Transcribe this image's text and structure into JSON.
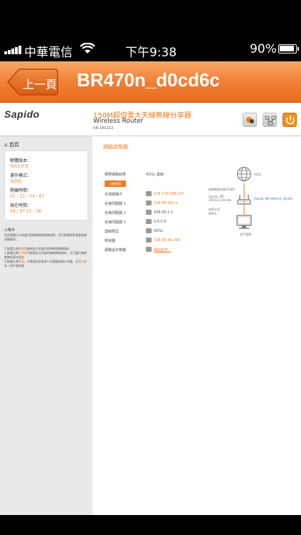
{
  "status_bar": {
    "carrier": "中華電信",
    "time": "下午9:38",
    "battery": "90%"
  },
  "nav": {
    "back_label": "上一頁",
    "title": "BR470n_d0cd6c"
  },
  "header": {
    "logo": "Sapido",
    "model_zh": "150M超值雲大天線無線分享器",
    "model_en": "Wireless Router",
    "model_no": "RB-1802G3"
  },
  "sidebar": {
    "home": "首頁",
    "firmware_label": "韌體版本：",
    "firmware_value": "Ver1.0.0",
    "mode_label": "運作模式：",
    "mode_value": "ADSL",
    "uptime_label": "開機時間：",
    "uptime_value": "01 : 12 : 34 : 47",
    "now_label": "現在時間：",
    "now_value": "04 / 07 21 : 38",
    "tip_title": "小幫手",
    "tip_body": "此頁面顯示分享器目前網際網路連線狀態，您可點擊按鈕查看連線詳細資訊。",
    "tip_steps_1a": "1.點選左側",
    "tip_steps_1b": "網路",
    "tip_steps_1c": "可檢視此分享器目前的網際網路資料",
    "tip_steps_2a": "2.點選左側",
    "tip_steps_2b": "分享器",
    "tip_steps_2c": "可檢視此分享器的無線網路資料，且可進行無線網路的基本設定",
    "tip_steps_3a": "3.點選左側",
    "tip_steps_3b": "電腦",
    "tip_steps_3c": "，可檢視目前有多少台電腦連線分享器，且可",
    "tip_steps_3d": "封鎖",
    "tip_steps_3e": "任一用戶端設備"
  },
  "main": {
    "panel_title": "網路狀態圖",
    "rows": {
      "type_label": "網際網路狀態",
      "type_value": "ADSL 連線",
      "detect_button": "自動偵測",
      "wan_ip_label": "外部網路IP",
      "wan_ip_value": "118.170.195.237",
      "dns1_label": "名稱伺服器 1",
      "dns1_value": "168.95.192.1",
      "dns2_label": "名稱伺服器 2",
      "dns2_value": "168.95.1.1",
      "dns3_label": "名稱伺服器 3",
      "dns3_value": "0.0.0.0",
      "conn_label": "連線類型",
      "conn_value": "ADSL",
      "gw_label": "閘道器",
      "gw_value": "168.95.98.254",
      "wifi_label": "網路設定精靈",
      "wifi_value": "開始設定..."
    },
    "diagram": {
      "internet": "ADSL",
      "ssid_label": "無線網路名稱(SSID):",
      "ssid_value": "Sapido_RB-1802G3_d0cd6c",
      "sec_label": "加密方式:",
      "sec_value": "WPA2",
      "router_name": "Sapido_RB-1802G3_d0cd6c",
      "pc_label": "用戶電腦"
    }
  },
  "colors": {
    "accent": "#f07a20",
    "nav_orange": "#ea6d20"
  }
}
